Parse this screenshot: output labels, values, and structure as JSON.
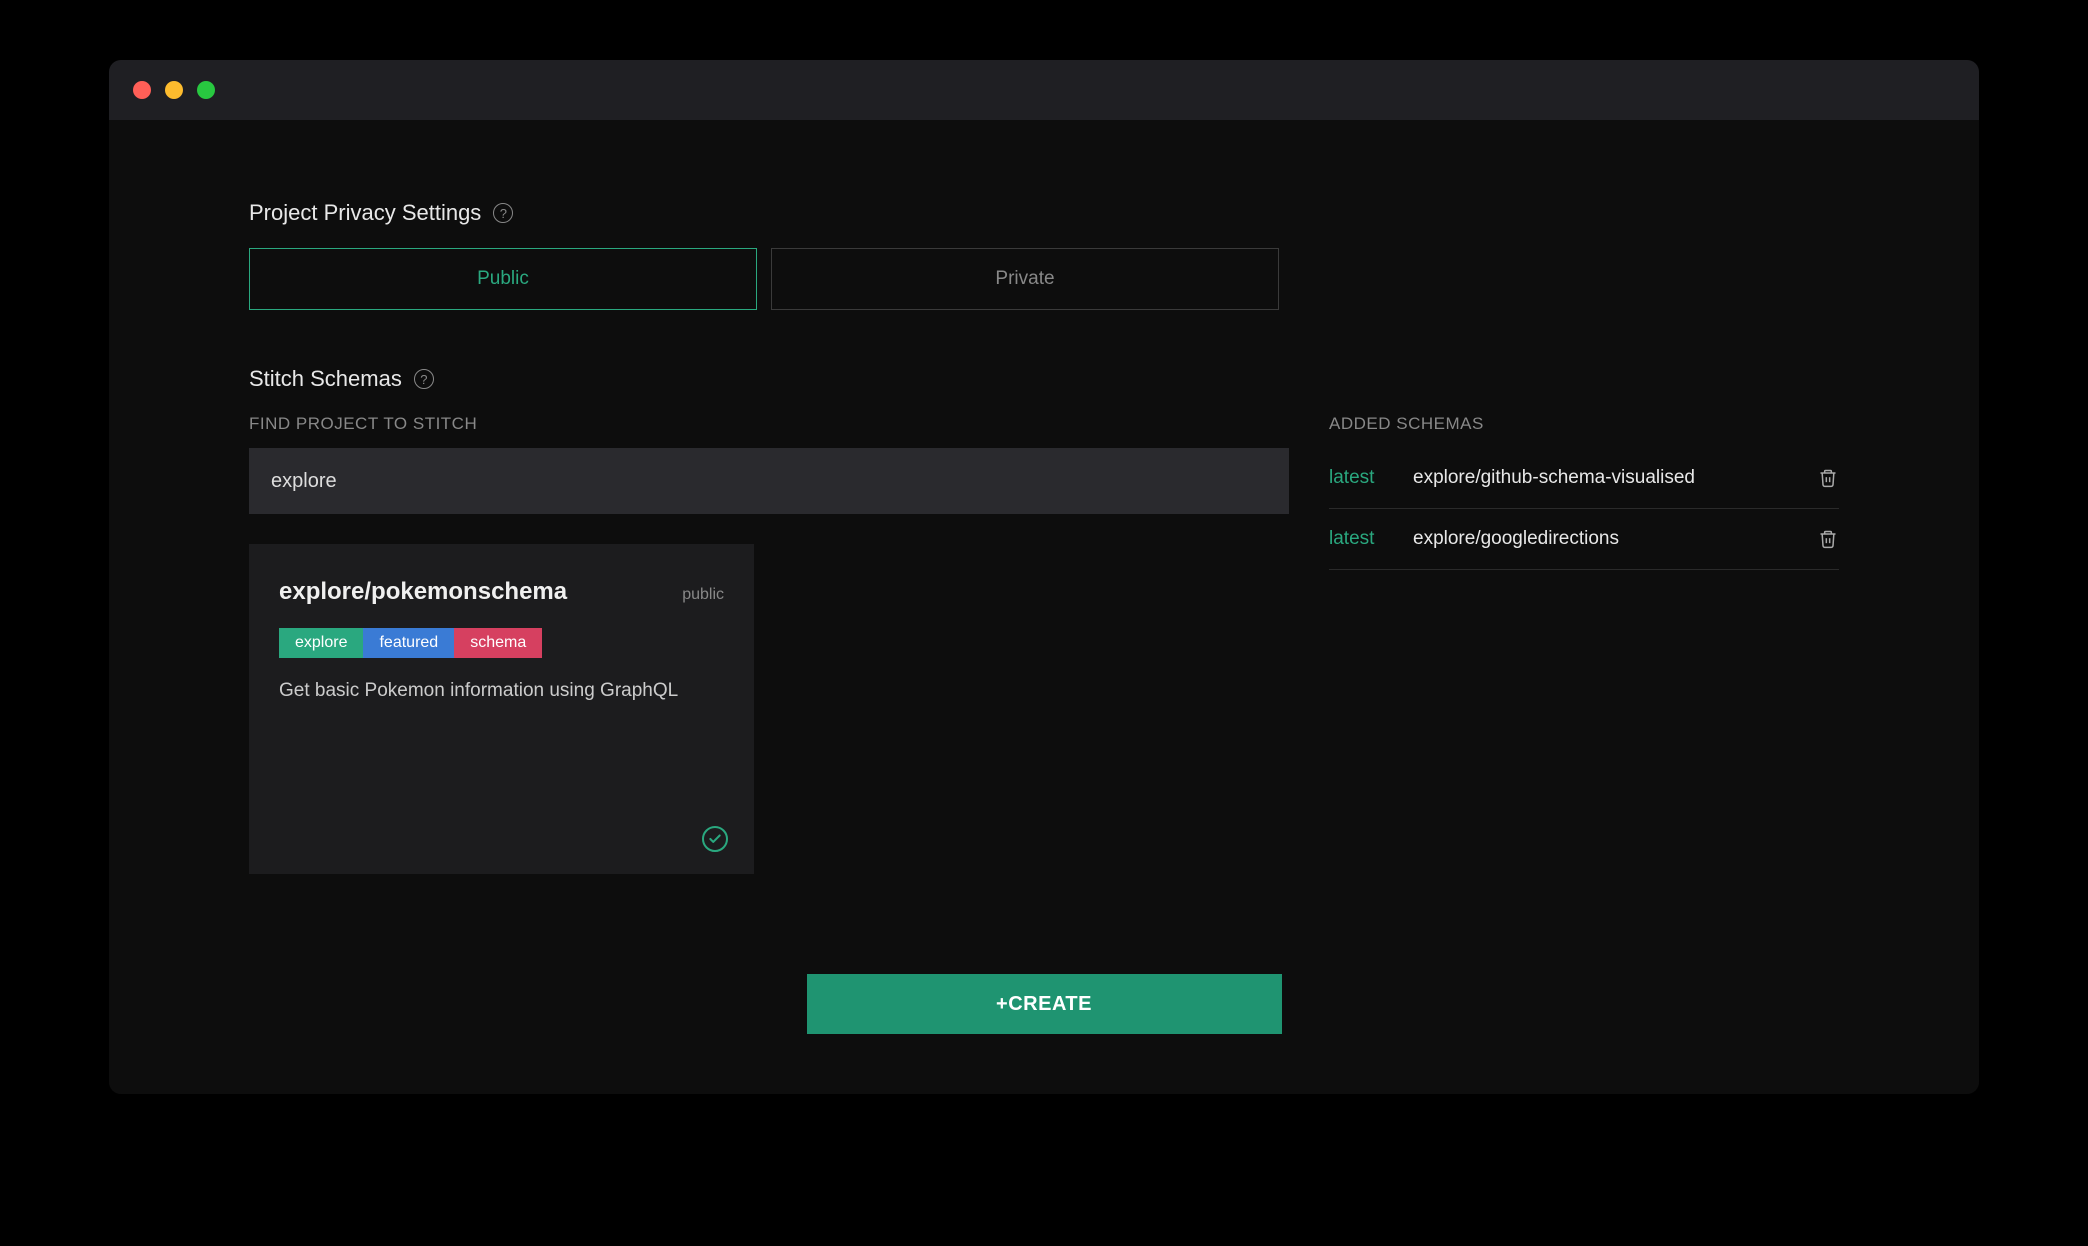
{
  "privacy": {
    "title": "Project Privacy Settings",
    "options": {
      "public": "Public",
      "private": "Private"
    },
    "selected": "public"
  },
  "stitch": {
    "title": "Stitch Schemas",
    "find_label": "FIND PROJECT TO STITCH",
    "search_value": "explore",
    "result": {
      "name": "explore/pokemonschema",
      "visibility": "public",
      "tags": [
        "explore",
        "featured",
        "schema"
      ],
      "description": "Get basic Pokemon information using GraphQL"
    }
  },
  "added": {
    "title": "ADDED SCHEMAS",
    "items": [
      {
        "version": "latest",
        "name": "explore/github-schema-visualised"
      },
      {
        "version": "latest",
        "name": "explore/googledirections"
      }
    ]
  },
  "create_button": "+CREATE"
}
